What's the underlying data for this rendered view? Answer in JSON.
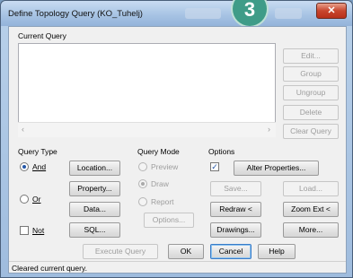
{
  "window": {
    "title": "Define Topology Query (KO_Tuhelj)",
    "close_glyph": "✕",
    "overlay_badge": "3"
  },
  "current_query": {
    "label": "Current Query",
    "scroll_left": "‹",
    "scroll_right": "›"
  },
  "side_buttons": [
    {
      "label": "Edit...",
      "enabled": false
    },
    {
      "label": "Group",
      "enabled": false
    },
    {
      "label": "Ungroup",
      "enabled": false
    },
    {
      "label": "Delete",
      "enabled": false
    },
    {
      "label": "Clear Query",
      "enabled": false
    }
  ],
  "query_type": {
    "label": "Query Type",
    "and_label": "And",
    "and_selected": true,
    "or_label": "Or",
    "or_selected": false,
    "not_label": "Not",
    "not_checked": false,
    "location_button": "Location...",
    "property_button": "Property...",
    "data_button": "Data...",
    "sql_button": "SQL..."
  },
  "query_mode": {
    "label": "Query Mode",
    "preview_label": "Preview",
    "draw_label": "Draw",
    "report_label": "Report",
    "options_button": "Options..."
  },
  "options": {
    "label": "Options",
    "alter_checked": true,
    "alter_properties_button": "Alter Properties...",
    "save_button": "Save...",
    "load_button": "Load...",
    "redraw_button": "Redraw <",
    "zoom_ext_button": "Zoom Ext <",
    "drawings_button": "Drawings...",
    "more_button": "More..."
  },
  "bottom_buttons": {
    "execute": "Execute Query",
    "ok": "OK",
    "cancel": "Cancel",
    "help": "Help"
  },
  "status_text": "Cleared current query."
}
